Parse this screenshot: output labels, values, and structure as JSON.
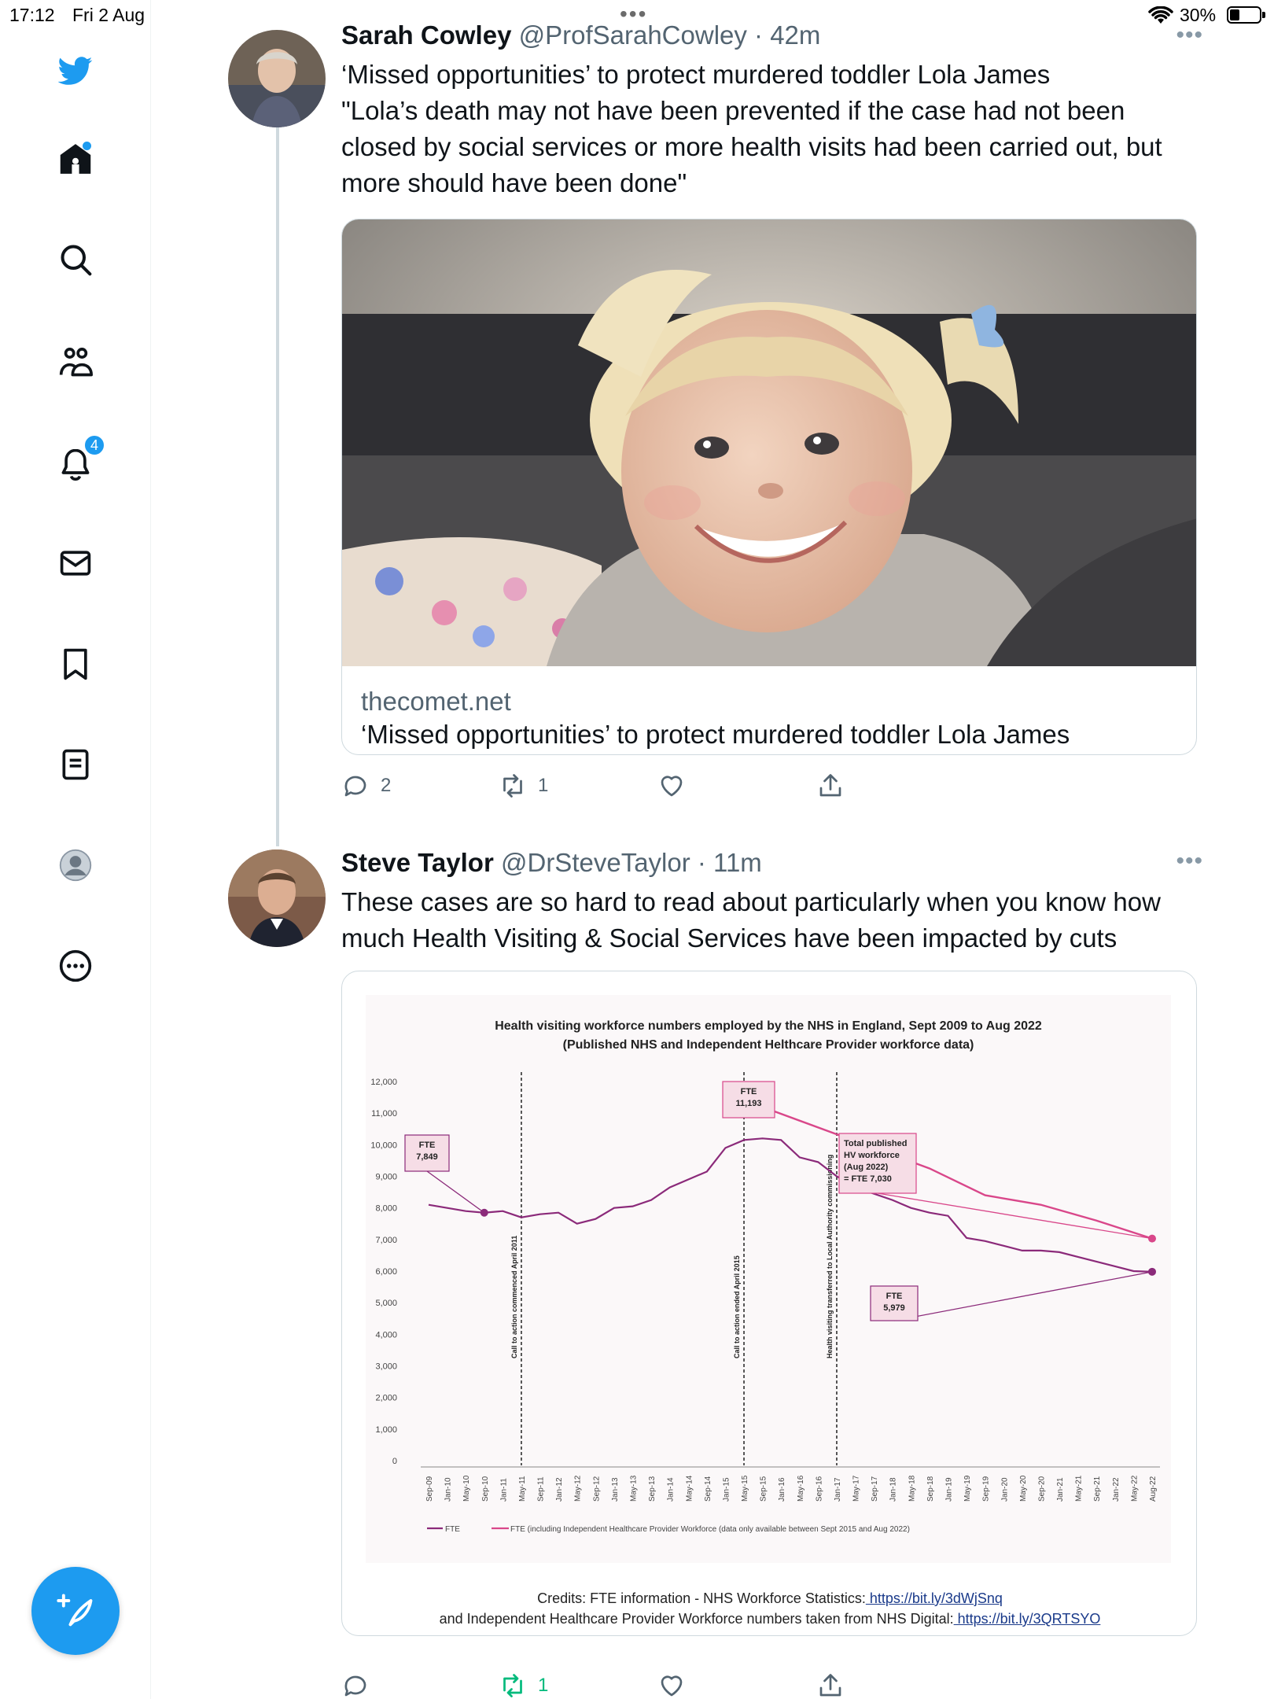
{
  "status_bar": {
    "time": "17:12",
    "date": "Fri 2 Aug",
    "battery": "30%",
    "battery_level": 0.3
  },
  "sidebar": {
    "items": [
      {
        "name": "twitter-logo"
      },
      {
        "name": "home",
        "has_dot": true
      },
      {
        "name": "explore"
      },
      {
        "name": "communities"
      },
      {
        "name": "notifications",
        "badge": "4"
      },
      {
        "name": "messages"
      },
      {
        "name": "bookmarks"
      },
      {
        "name": "lists"
      },
      {
        "name": "profile"
      },
      {
        "name": "more"
      }
    ],
    "compose_icon": "feather-plus-icon"
  },
  "tweets": [
    {
      "name": "Sarah Cowley",
      "handle": "@ProfSarahCowley",
      "time": "· 42m",
      "lines": [
        "‘Missed opportunities’ to protect murdered toddler Lola James",
        "\"Lola’s death may not have been prevented if the case had not been",
        "closed by social services or more health visits had been carried out, but",
        "more should have been done\""
      ],
      "card": {
        "domain": "thecomet.net",
        "title": "‘Missed opportunities’ to protect murdered toddler Lola James"
      },
      "actions": {
        "replies": "2",
        "retweets": "1",
        "likes": "",
        "share": ""
      }
    },
    {
      "name": "Steve Taylor",
      "handle": "@DrSteveTaylor",
      "time": "· 11m",
      "lines": [
        "These cases are so hard to read about particularly when you know how",
        "much Health Visiting & Social Services have been impacted by cuts"
      ],
      "actions": {
        "replies": "",
        "retweets": "1",
        "likes": "",
        "share": ""
      },
      "credits": {
        "line1_prefix": "Credits: FTE information - NHS Workforce Statistics:",
        "line1_link": " https://bit.ly/3dWjSnq",
        "line2_prefix": "and Independent Healthcare Provider Workforce numbers taken from NHS Digital:",
        "line2_link": " https://bit.ly/3QRTSYO"
      }
    }
  ],
  "chart_data": {
    "type": "line",
    "title": "Health visiting workforce numbers employed by the NHS in England, Sept 2009 to Aug 2022",
    "subtitle": "(Published NHS and Independent Helthcare Provider workforce data)",
    "ylim": [
      0,
      12000
    ],
    "yticks": [
      "0",
      "1,000",
      "2,000",
      "3,000",
      "4,000",
      "5,000",
      "6,000",
      "7,000",
      "8,000",
      "9,000",
      "10,000",
      "11,000",
      "12,000"
    ],
    "categories": [
      "Sep-09",
      "Jan-10",
      "May-10",
      "Sep-10",
      "Jan-11",
      "May-11",
      "Sep-11",
      "Jan-12",
      "May-12",
      "Sep-12",
      "Jan-13",
      "May-13",
      "Sep-13",
      "Jan-14",
      "May-14",
      "Sep-14",
      "Jan-15",
      "May-15",
      "Sep-15",
      "Jan-16",
      "May-16",
      "Sep-16",
      "Jan-17",
      "May-17",
      "Sep-17",
      "Jan-18",
      "May-18",
      "Sep-18",
      "Jan-19",
      "May-19",
      "Sep-19",
      "Jan-20",
      "May-20",
      "Sep-20",
      "Jan-21",
      "May-21",
      "Sep-21",
      "Jan-22",
      "May-22",
      "Aug-22"
    ],
    "series": [
      {
        "name": "FTE",
        "color": "#8b2a7a",
        "values": [
          8100,
          8000,
          7900,
          7849,
          7900,
          7700,
          7800,
          7850,
          7500,
          7650,
          8000,
          8050,
          8250,
          8650,
          8900,
          9150,
          9900,
          10150,
          10200,
          10150,
          9600,
          9450,
          9000,
          8650,
          8450,
          8250,
          8000,
          7850,
          7750,
          7050,
          6950,
          6800,
          6650,
          6650,
          6600,
          6450,
          6300,
          6150,
          6000,
          5979
        ]
      },
      {
        "name": "FTE (including Independent Healthcare Provider Workforce (data only available between Sept 2015 and Aug 2022)",
        "color": "#d9478a",
        "x": [
          "Sep-15",
          "Sep-18",
          "Sep-19",
          "Sep-20",
          "Sep-21",
          "Aug-22"
        ],
        "values": [
          11193,
          9250,
          8400,
          8100,
          7600,
          7030
        ]
      }
    ],
    "vlines": [
      {
        "at": "May-11",
        "label": "Call to action commenced April 2011"
      },
      {
        "at": "May-15",
        "label": "Call to action ended April 2015"
      },
      {
        "at": "Jan-17",
        "label": "Health visiting transferred to Local Authority commissioning"
      }
    ],
    "annotations": [
      {
        "lines": [
          "FTE",
          "7,849"
        ]
      },
      {
        "lines": [
          "FTE",
          "11,193"
        ]
      },
      {
        "lines": [
          "Total published",
          "HV workforce",
          "(Aug 2022)",
          "= FTE 7,030"
        ]
      },
      {
        "lines": [
          "FTE",
          "5,979"
        ]
      }
    ],
    "legend": "bottom"
  }
}
